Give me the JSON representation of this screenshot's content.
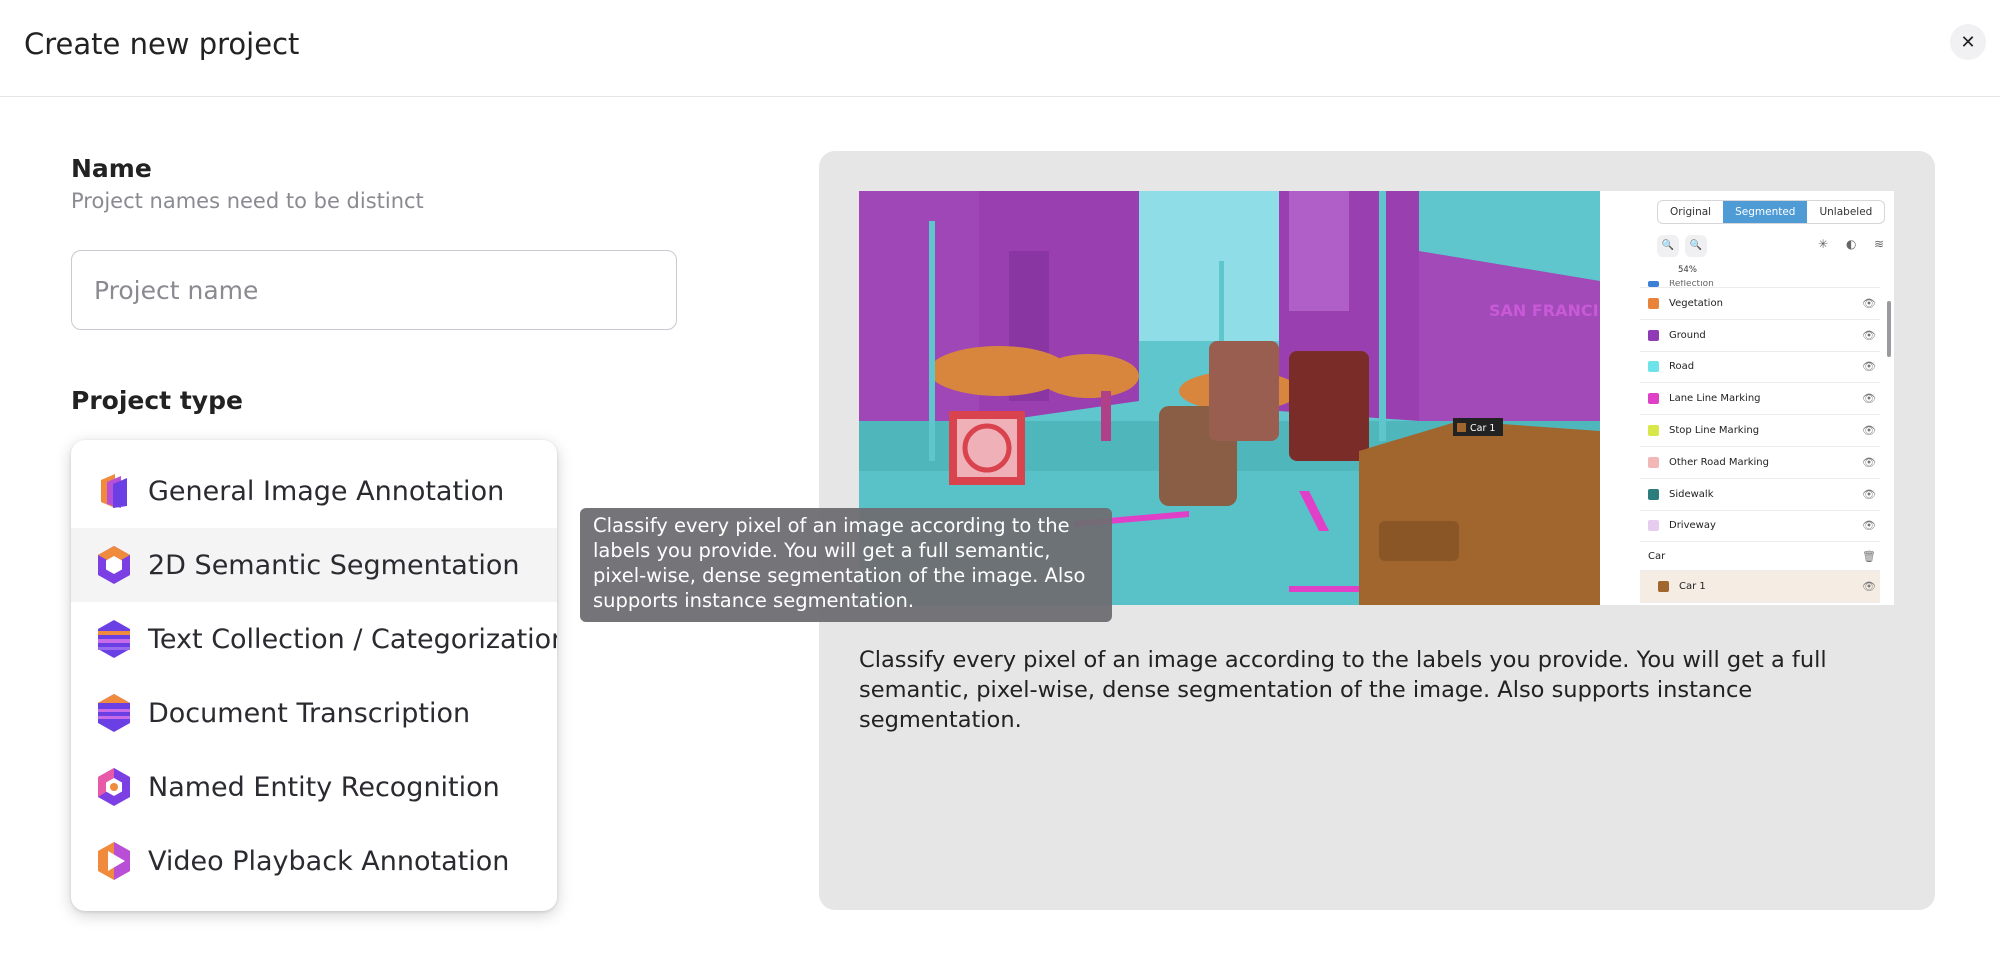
{
  "header": {
    "title": "Create new project",
    "close_symbol": "✕"
  },
  "form": {
    "name_label": "Name",
    "name_hint": "Project names need to be distinct",
    "name_placeholder": "Project name",
    "type_label": "Project type"
  },
  "project_types": [
    {
      "label": "General Image Annotation",
      "icon": "layers-icon"
    },
    {
      "label": "2D Semantic Segmentation",
      "icon": "hexagon-ring-icon"
    },
    {
      "label": "Text Collection / Categorization",
      "icon": "hexagon-stripes-icon"
    },
    {
      "label": "Document Transcription",
      "icon": "hexagon-stripes-icon"
    },
    {
      "label": "Named Entity Recognition",
      "icon": "hexagon-dot-icon"
    },
    {
      "label": "Video Playback Annotation",
      "icon": "play-icon"
    }
  ],
  "active_type_index": 1,
  "tooltip": {
    "text": "Classify every pixel of an image according to the labels you provide. You will get a full semantic, pixel-wise, dense segmentation of the image. Also supports instance segmentation."
  },
  "preview": {
    "description": "Classify every pixel of an image according to the labels you provide. You will get a full semantic, pixel-wise, dense segmentation of the image. Also supports instance segmentation.",
    "car_tag": "Car 1",
    "building_sign": "SAN FRANCISC",
    "panel": {
      "toggles": [
        "Original",
        "Segmented",
        "Unlabeled"
      ],
      "active_toggle": 1,
      "zoom_out": "🔍",
      "zoom_in": "🔍",
      "zoom_level": "54%",
      "tools": [
        "✳",
        "◐",
        "≋"
      ],
      "partial_row": "Reflection",
      "eye": "👁",
      "trash": "🗑",
      "labels": [
        {
          "name": "Vegetation",
          "color": "#e8833a"
        },
        {
          "name": "Ground",
          "color": "#8e3bb5"
        },
        {
          "name": "Road",
          "color": "#6fe3ea"
        },
        {
          "name": "Lane Line Marking",
          "color": "#e040c8"
        },
        {
          "name": "Stop Line Marking",
          "color": "#d8e84a"
        },
        {
          "name": "Other Road Marking",
          "color": "#f2b8b8"
        },
        {
          "name": "Sidewalk",
          "color": "#2e7d7d"
        },
        {
          "name": "Driveway",
          "color": "#e6cdf0"
        }
      ],
      "group_label": "Car",
      "instance": {
        "name": "Car 1",
        "color": "#a0662e"
      }
    }
  },
  "colors": {
    "accent_purple": "#7b3fe4",
    "accent_orange": "#f08a3c",
    "segmented_blue": "#4e9bd6",
    "preview_bg": "#e6e6e6"
  }
}
